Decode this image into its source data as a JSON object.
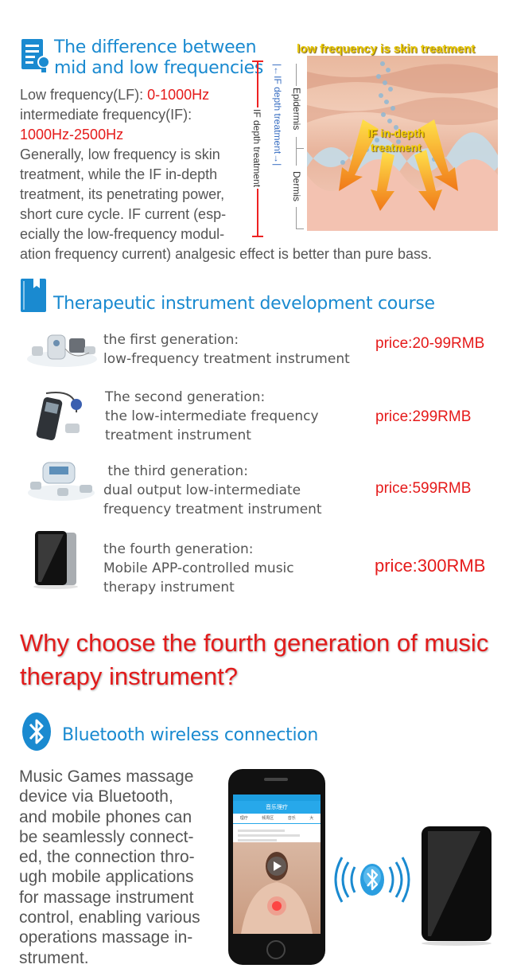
{
  "section1": {
    "title_line1": "The difference between",
    "title_line2": "mid and low frequencies",
    "lf_label": "Low frequency(LF): ",
    "lf_value": "0-1000Hz",
    "if_label": "intermediate frequency(IF):",
    "if_value": "1000Hz-2500Hz",
    "para": [
      "Generally, low frequency is skin",
      "treatment, while the IF in-depth",
      "treatment, its penetrating power,",
      "short cure cycle. IF current (esp-",
      "ecially the low-frequency modul-"
    ],
    "para_last": "ation frequency current) analgesic effect is better than pure bass.",
    "diagram": {
      "top_label": "low frequency is skin treatment",
      "if_label_1": "IF in-depth",
      "if_label_2": "treatment",
      "epidermis": "Epidermis",
      "dermis": "Dermis",
      "if_depth_1": "|←IF depth treatment→|",
      "if_depth_2": "IF depth treatment"
    }
  },
  "section2": {
    "title": "Therapeutic instrument development course",
    "generations": [
      {
        "line1": "the first generation:",
        "line2": "low-frequency treatment instrument",
        "line3": "",
        "price": "price:20-99RMB"
      },
      {
        "line1": "The second generation:",
        "line2": "the low-intermediate frequency",
        "line3": "treatment instrument",
        "price": "price:299RMB"
      },
      {
        "line1": " the third generation:",
        "line2": "dual output low-intermediate",
        "line3": "frequency treatment instrument",
        "price": "price:599RMB"
      },
      {
        "line1": "the fourth generation:",
        "line2": "Mobile APP-controlled music",
        "line3": "therapy instrument",
        "price": "price:300RMB"
      }
    ]
  },
  "why": {
    "line1": "Why choose the fourth generation of music",
    "line2": "therapy instrument?"
  },
  "section3": {
    "title": "Bluetooth wireless connection",
    "para": [
      "Music Games massage",
      "device via Bluetooth,",
      "and mobile phones can",
      "be seamlessly connect-",
      "ed, the connection thro-",
      "ugh mobile applications",
      "for massage instrument",
      "control, enabling various",
      "operations massage in-",
      "strument."
    ],
    "phone_app_title": "音乐理疗",
    "phone_tabs": [
      "理疗",
      "频周区",
      "音乐",
      "大"
    ]
  },
  "colors": {
    "accent": "#1a8ad0",
    "price": "#e51a1a"
  }
}
